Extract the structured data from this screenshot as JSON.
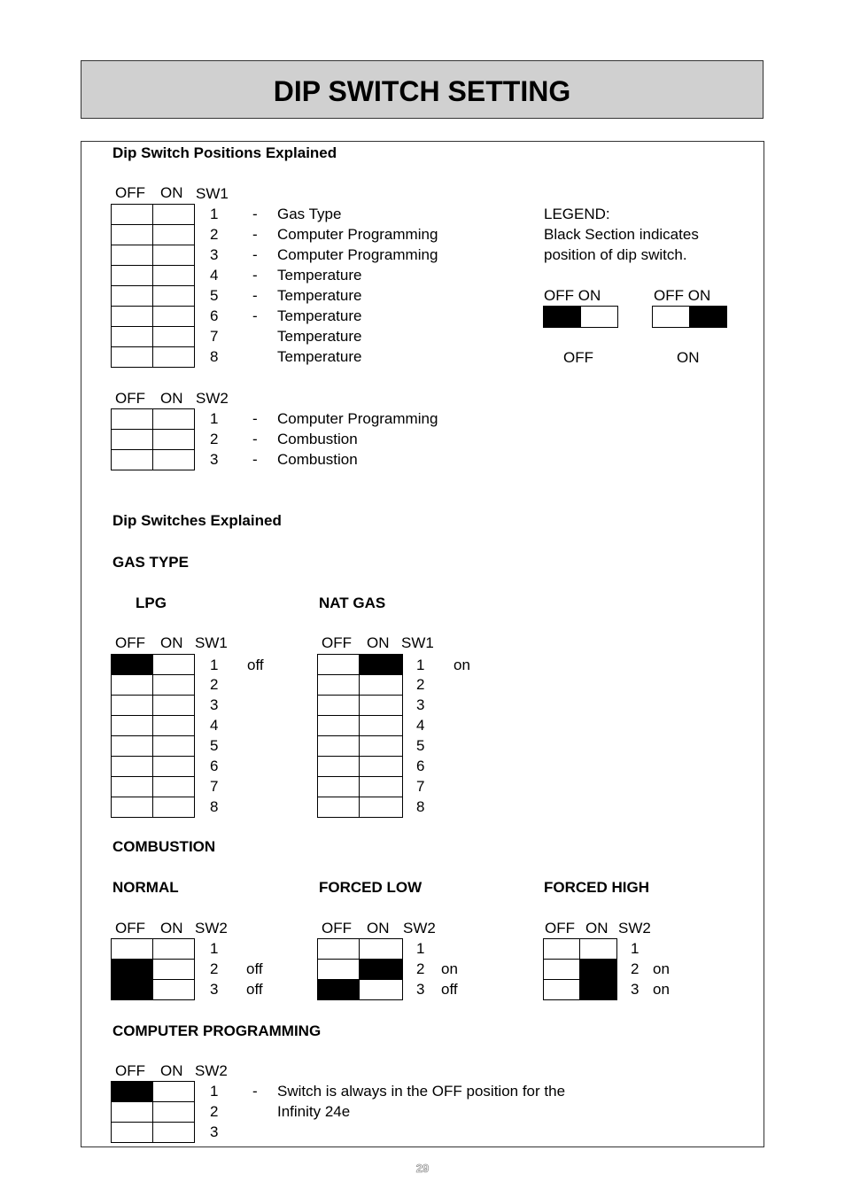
{
  "page_title": "DIP SWITCH SETTING",
  "page_number": "29",
  "positions_section": {
    "heading": "Dip Switch Positions Explained",
    "sw1": {
      "header": {
        "off": "OFF",
        "on": "ON",
        "name": "SW1"
      },
      "rows": [
        {
          "num": "1",
          "dash": "-",
          "label": "Gas Type"
        },
        {
          "num": "2",
          "dash": "-",
          "label": "Computer Programming"
        },
        {
          "num": "3",
          "dash": "-",
          "label": "Computer Programming"
        },
        {
          "num": "4",
          "dash": "-",
          "label": "Temperature"
        },
        {
          "num": "5",
          "dash": "-",
          "label": "Temperature"
        },
        {
          "num": "6",
          "dash": "-",
          "label": "Temperature"
        },
        {
          "num": "7",
          "dash": "",
          "label": "Temperature"
        },
        {
          "num": "8",
          "dash": "",
          "label": "Temperature"
        }
      ]
    },
    "sw2": {
      "header": {
        "off": "OFF",
        "on": "ON",
        "name": "SW2"
      },
      "rows": [
        {
          "num": "1",
          "dash": "-",
          "label": "Computer Programming"
        },
        {
          "num": "2",
          "dash": "-",
          "label": "Combustion"
        },
        {
          "num": "3",
          "dash": "-",
          "label": "Combustion"
        }
      ]
    },
    "legend": {
      "title": "LEGEND:",
      "line1": "Black Section indicates",
      "line2": "position of dip switch.",
      "examples": [
        {
          "header": "OFF ON",
          "state": "off",
          "caption": "OFF"
        },
        {
          "header": "OFF ON",
          "state": "on",
          "caption": "ON"
        }
      ]
    }
  },
  "explained_section": {
    "heading": "Dip Switches Explained",
    "gas_type": {
      "heading": "GAS TYPE",
      "options": [
        {
          "name": "LPG",
          "header": {
            "off": "OFF",
            "on": "ON",
            "name": "SW1"
          },
          "switches": [
            {
              "num": "1",
              "state": "off",
              "note": "off"
            },
            {
              "num": "2",
              "state": "",
              "note": ""
            },
            {
              "num": "3",
              "state": "",
              "note": ""
            },
            {
              "num": "4",
              "state": "",
              "note": ""
            },
            {
              "num": "5",
              "state": "",
              "note": ""
            },
            {
              "num": "6",
              "state": "",
              "note": ""
            },
            {
              "num": "7",
              "state": "",
              "note": ""
            },
            {
              "num": "8",
              "state": "",
              "note": ""
            }
          ]
        },
        {
          "name": "NAT GAS",
          "header": {
            "off": "OFF",
            "on": "ON",
            "name": "SW1"
          },
          "switches": [
            {
              "num": "1",
              "state": "on",
              "note": "on"
            },
            {
              "num": "2",
              "state": "",
              "note": ""
            },
            {
              "num": "3",
              "state": "",
              "note": ""
            },
            {
              "num": "4",
              "state": "",
              "note": ""
            },
            {
              "num": "5",
              "state": "",
              "note": ""
            },
            {
              "num": "6",
              "state": "",
              "note": ""
            },
            {
              "num": "7",
              "state": "",
              "note": ""
            },
            {
              "num": "8",
              "state": "",
              "note": ""
            }
          ]
        }
      ]
    },
    "combustion": {
      "heading": "COMBUSTION",
      "options": [
        {
          "name": "NORMAL",
          "header": {
            "off": "OFF",
            "on": "ON",
            "name": "SW2"
          },
          "switches": [
            {
              "num": "1",
              "state": "",
              "note": ""
            },
            {
              "num": "2",
              "state": "off",
              "note": "off"
            },
            {
              "num": "3",
              "state": "off",
              "note": "off"
            }
          ]
        },
        {
          "name": "FORCED LOW",
          "header": {
            "off": "OFF",
            "on": "ON",
            "name": "SW2"
          },
          "switches": [
            {
              "num": "1",
              "state": "",
              "note": ""
            },
            {
              "num": "2",
              "state": "on",
              "note": "on"
            },
            {
              "num": "3",
              "state": "off",
              "note": "off"
            }
          ]
        },
        {
          "name": "FORCED HIGH",
          "header": {
            "off": "OFF",
            "on": "ON",
            "name": "SW2"
          },
          "switches": [
            {
              "num": "1",
              "state": "",
              "note": ""
            },
            {
              "num": "2",
              "state": "on",
              "note": "on"
            },
            {
              "num": "3",
              "state": "on",
              "note": "on"
            }
          ]
        }
      ]
    },
    "computer_programming": {
      "heading": "COMPUTER PROGRAMMING",
      "header": {
        "off": "OFF",
        "on": "ON",
        "name": "SW2"
      },
      "switches": [
        {
          "num": "1",
          "state": "off"
        },
        {
          "num": "2",
          "state": ""
        },
        {
          "num": "3",
          "state": ""
        }
      ],
      "dash": "-",
      "note_line1": "Switch is always in the OFF position for the",
      "note_line2": "Infinity 24e"
    }
  }
}
